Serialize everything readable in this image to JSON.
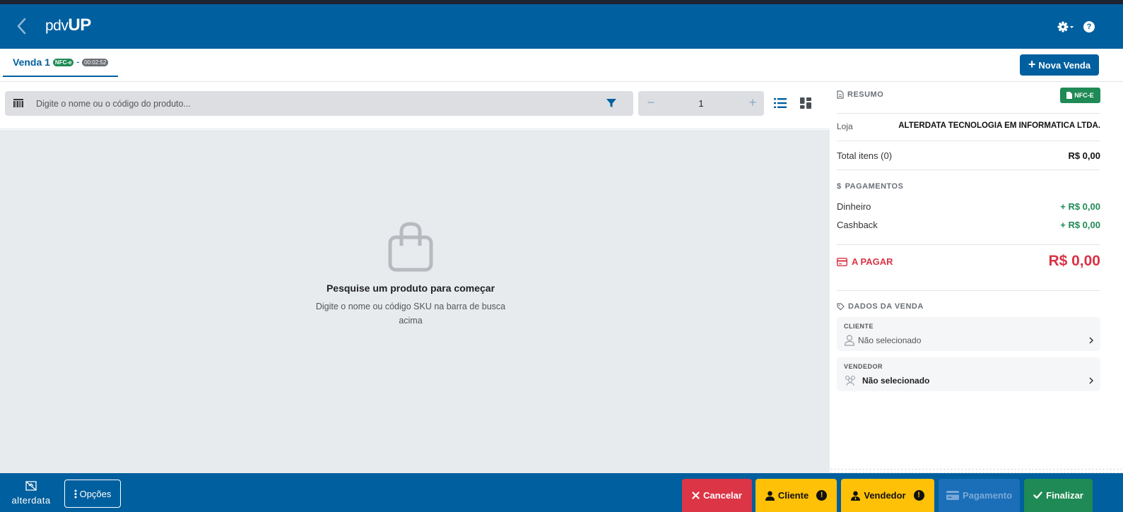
{
  "app": {
    "logo_prefix": "pdv",
    "logo_suffix": "UP"
  },
  "tab": {
    "label": "Venda 1",
    "doc_badge": "NFC-e",
    "separator": "-",
    "timer": "00:02:52"
  },
  "toolbar": {
    "new_sale_label": "Nova Venda"
  },
  "search": {
    "placeholder": "Digite o nome ou o código do produto...",
    "quantity": "1",
    "qty_minus": "−",
    "qty_plus": "+"
  },
  "empty_state": {
    "title": "Pesquise um produto para começar",
    "subtitle": "Digite o nome ou código SKU na barra de busca acima"
  },
  "summary": {
    "heading": "RESUMO",
    "doc_pill": "NFC-E",
    "store_label": "Loja",
    "store_value": "ALTERDATA TECNOLOGIA EM INFORMATICA LTDA.",
    "total_items_label": "Total itens (0)",
    "total_items_value": "R$ 0,00"
  },
  "payments": {
    "heading": "PAGAMENTOS",
    "rows": [
      {
        "label": "Dinheiro",
        "value": "+ R$ 0,00"
      },
      {
        "label": "Cashback",
        "value": "+ R$ 0,00"
      }
    ],
    "to_pay_label": "A PAGAR",
    "to_pay_value": "R$ 0,00"
  },
  "sale_data": {
    "heading": "DADOS DA VENDA",
    "client_title": "CLIENTE",
    "client_value": "Não selecionado",
    "seller_title": "VENDEDOR",
    "seller_value": "Não selecionado"
  },
  "footer": {
    "brand": "alterdata",
    "options_label": "Opções",
    "cancel_label": "Cancelar",
    "client_label": "Cliente",
    "seller_label": "Vendedor",
    "payment_label": "Pagamento",
    "finish_label": "Finalizar",
    "warning_mark": "!"
  },
  "colors": {
    "primary": "#005f9e",
    "success": "#1f8a55",
    "danger": "#dc3545",
    "warning": "#ffc107"
  }
}
